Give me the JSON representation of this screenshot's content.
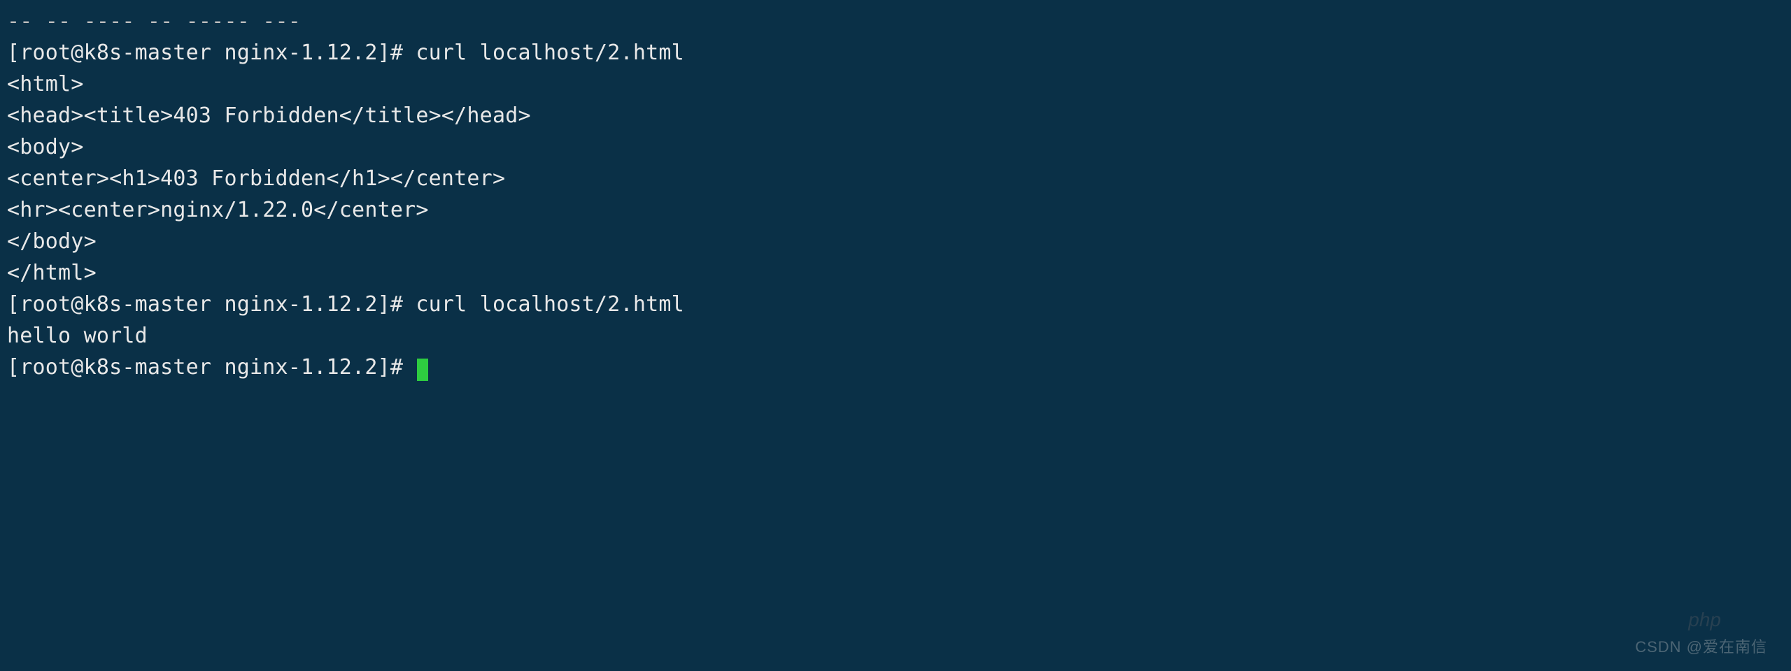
{
  "terminal": {
    "lines": {
      "l0": "-- -- ---- -- ----- ---",
      "l1": "[root@k8s-master nginx-1.12.2]# curl localhost/2.html",
      "l2": "<html>",
      "l3": "<head><title>403 Forbidden</title></head>",
      "l4": "<body>",
      "l5": "<center><h1>403 Forbidden</h1></center>",
      "l6": "<hr><center>nginx/1.22.0</center>",
      "l7": "</body>",
      "l8": "</html>",
      "l9": "[root@k8s-master nginx-1.12.2]# curl localhost/2.html",
      "l10": "hello world",
      "l11": "[root@k8s-master nginx-1.12.2]# "
    }
  },
  "watermark": {
    "text": "CSDN @爱在南信",
    "ghost": "php"
  },
  "colors": {
    "background": "#0a3047",
    "foreground": "#e8e8e8",
    "cursor": "#2ecc40"
  }
}
